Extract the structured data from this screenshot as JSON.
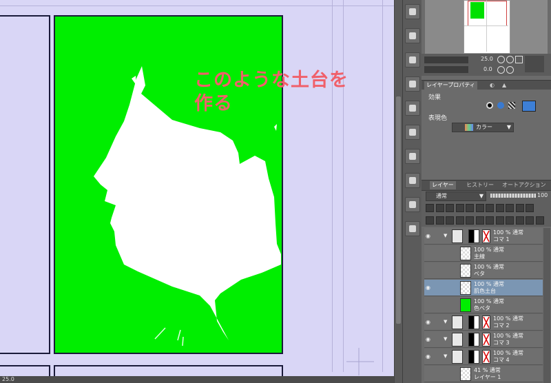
{
  "annotation": {
    "text": "このような土台を\n作る"
  },
  "colors": {
    "canvas_bg": "#d9d6f6",
    "green_fill": "#00ee00",
    "annotation": "#f0606a",
    "panel_bg": "#6b6b6b",
    "selected_layer": "#7b96b3"
  },
  "navigator": {
    "zoom_value": "25.0",
    "rotate_value": "0.0"
  },
  "properties": {
    "tab_label": "レイヤープロパティ",
    "effect_label": "効果",
    "color_label": "表現色",
    "color_value": "カラー"
  },
  "layer_panel": {
    "tabs": [
      "レイヤー",
      "ヒストリー",
      "オートアクション"
    ],
    "blend_mode": "通常",
    "opacity": "100",
    "layers": [
      {
        "line1": "100 % 通常",
        "line2": "コマ 1",
        "type": "folder",
        "selected": false,
        "visible": true
      },
      {
        "line1": "100 % 通常",
        "line2": "主線",
        "type": "raster",
        "selected": false,
        "visible": false
      },
      {
        "line1": "100 % 通常",
        "line2": "ベタ",
        "type": "raster",
        "selected": false,
        "visible": false
      },
      {
        "line1": "100 % 通常",
        "line2": "肌色土台",
        "type": "raster",
        "selected": true,
        "visible": true
      },
      {
        "line1": "100 % 通常",
        "line2": "色ベタ",
        "type": "green",
        "selected": false,
        "visible": false
      },
      {
        "line1": "100 % 通常",
        "line2": "コマ 2",
        "type": "folder",
        "selected": false,
        "visible": true
      },
      {
        "line1": "100 % 通常",
        "line2": "コマ 3",
        "type": "folder",
        "selected": false,
        "visible": true
      },
      {
        "line1": "100 % 通常",
        "line2": "コマ 4",
        "type": "folder",
        "selected": false,
        "visible": true
      },
      {
        "line1": "41 % 通常",
        "line2": "レイヤー 1",
        "type": "raster",
        "selected": false,
        "visible": false
      }
    ]
  },
  "status_bar": {
    "zoom": "25.0"
  },
  "tools": [
    "sub-tool-icon-1",
    "sub-tool-icon-2",
    "sub-tool-icon-3",
    "sub-tool-icon-4",
    "sub-tool-icon-5",
    "sub-tool-icon-6",
    "sub-tool-icon-7",
    "sub-tool-icon-8",
    "sub-tool-icon-9",
    "sub-tool-icon-10"
  ]
}
